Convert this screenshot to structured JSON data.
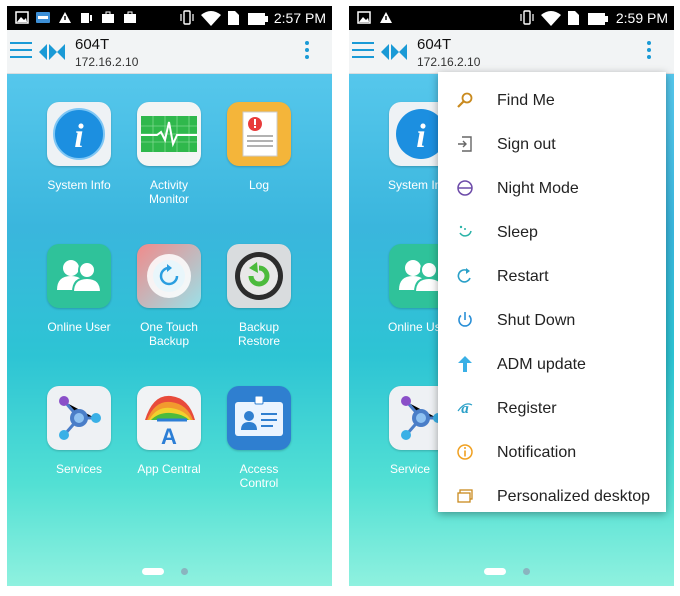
{
  "left_screen": {
    "status_time": "2:57 PM",
    "device_name": "604T",
    "device_ip": "172.16.2.10",
    "apps": [
      {
        "label": "System Info",
        "icon": "info-icon"
      },
      {
        "label": "Activity\nMonitor",
        "icon": "heartbeat-icon"
      },
      {
        "label": "Log",
        "icon": "log-document-icon"
      },
      {
        "label": "Online User",
        "icon": "users-icon"
      },
      {
        "label": "One Touch\nBackup",
        "icon": "refresh-icon"
      },
      {
        "label": "Backup\nRestore",
        "icon": "restore-icon"
      },
      {
        "label": "Services",
        "icon": "services-node-icon"
      },
      {
        "label": "App Central",
        "icon": "app-central-icon"
      },
      {
        "label": "Access\nControl",
        "icon": "id-card-icon"
      }
    ]
  },
  "right_screen": {
    "status_time": "2:59 PM",
    "device_name": "604T",
    "device_ip": "172.16.2.10",
    "background_labels": [
      "System In",
      "Online Us",
      "Service"
    ],
    "menu": [
      {
        "label": "Find Me",
        "icon": "magnifier-icon"
      },
      {
        "label": "Sign out",
        "icon": "sign-out-icon"
      },
      {
        "label": "Night Mode",
        "icon": "night-mode-icon"
      },
      {
        "label": "Sleep",
        "icon": "sleep-icon"
      },
      {
        "label": "Restart",
        "icon": "restart-icon"
      },
      {
        "label": "Shut Down",
        "icon": "power-icon"
      },
      {
        "label": "ADM update",
        "icon": "upload-arrow-icon"
      },
      {
        "label": "Register",
        "icon": "register-icon"
      },
      {
        "label": "Notification",
        "icon": "info-circle-icon"
      },
      {
        "label": "Personalized desktop",
        "icon": "desktop-icon"
      }
    ]
  },
  "colors": {
    "accent": "#1a9ad6",
    "status_bar": "#000000",
    "app_bar": "#f2f4f5",
    "menu_icon_orange": "#f0a020",
    "menu_icon_purple": "#6c4aa8"
  }
}
